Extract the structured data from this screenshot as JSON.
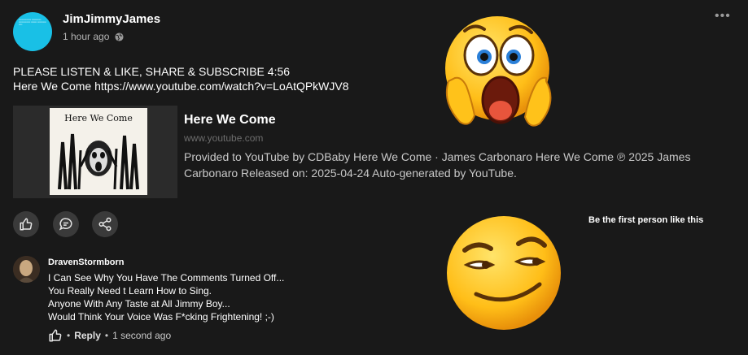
{
  "post": {
    "author": "JimJimmyJames",
    "time": "1 hour ago",
    "text_line1": "PLEASE LISTEN & LIKE, SHARE & SUBSCRIBE 4:56",
    "text_line2": "Here We Come https://www.youtube.com/watch?v=LoAtQPkWJV8"
  },
  "link_preview": {
    "thumbnail_title": "Here We Come",
    "title": "Here We Come",
    "domain": "www.youtube.com",
    "description": "Provided to YouTube by CDBaby Here We Come · James Carbonaro Here We Come ℗ 2025 James Carbonaro Released on: 2025-04-24 Auto-generated by YouTube."
  },
  "actions": {
    "like_icon": "thumbs-up-icon",
    "comment_icon": "comment-icon",
    "share_icon": "share-icon",
    "first_like_text": "Be the first person like this"
  },
  "comment": {
    "author": "DravenStormborn",
    "lines": [
      "I Can See Why You Have The Comments Turned Off...",
      "You Really Need t Learn How to Sing.",
      "Anyone With Any Taste at All Jimmy Boy...",
      "Would Think Your Voice Was F*cking Frightening! ;-)"
    ],
    "reply_label": "Reply",
    "time": "1 second ago",
    "separator": "•"
  },
  "colors": {
    "background": "#191919",
    "avatar": "#19c0e6",
    "button_bg": "#3a3a3a",
    "muted_text": "#b5b5b5",
    "emoji_yellow": "#ffc21a"
  }
}
